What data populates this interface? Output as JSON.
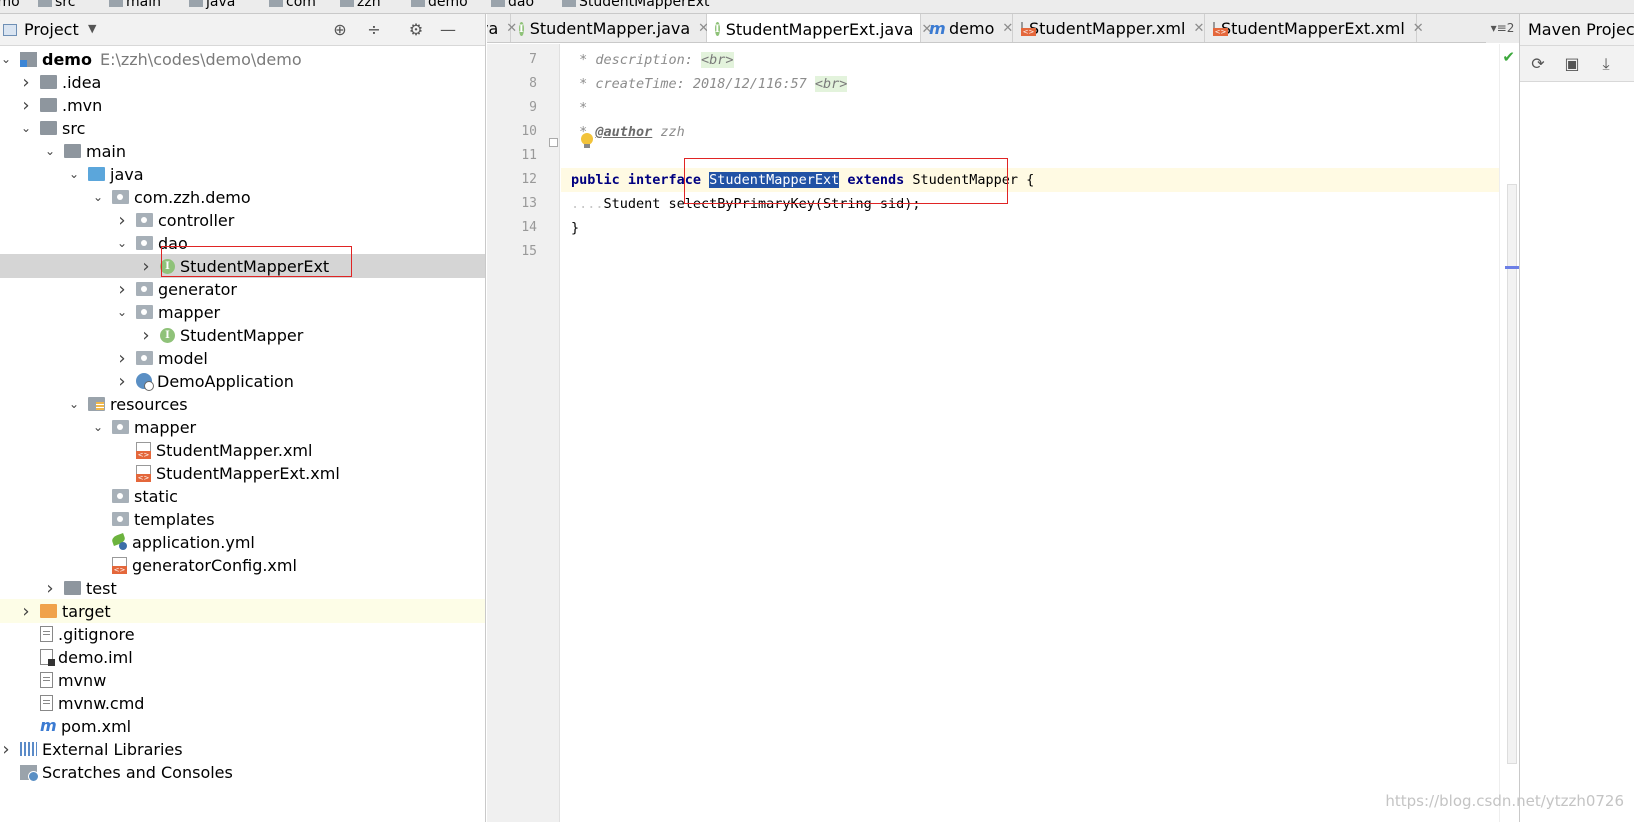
{
  "breadcrumb": [
    "demo",
    "src",
    "main",
    "java",
    "com",
    "zzh",
    "demo",
    "dao",
    "StudentMapperExt"
  ],
  "project_panel": {
    "title": "Project",
    "tree": [
      {
        "label": "demo",
        "path": "E:\\zzh\\codes\\demo\\demo",
        "depth": 0,
        "arrow": "down",
        "icon": "module-icon",
        "bold": true
      },
      {
        "label": ".idea",
        "depth": 1,
        "arrow": "right",
        "icon": "folder-icon"
      },
      {
        "label": ".mvn",
        "depth": 1,
        "arrow": "right",
        "icon": "folder-icon"
      },
      {
        "label": "src",
        "depth": 1,
        "arrow": "down",
        "icon": "folder-icon"
      },
      {
        "label": "main",
        "depth": 2,
        "arrow": "down",
        "icon": "folder-icon"
      },
      {
        "label": "java",
        "depth": 3,
        "arrow": "down",
        "icon": "source-folder-icon"
      },
      {
        "label": "com.zzh.demo",
        "depth": 4,
        "arrow": "down",
        "icon": "package-icon"
      },
      {
        "label": "controller",
        "depth": 5,
        "arrow": "right",
        "icon": "package-icon"
      },
      {
        "label": "dao",
        "depth": 5,
        "arrow": "down",
        "icon": "package-icon"
      },
      {
        "label": "StudentMapperExt",
        "depth": 6,
        "arrow": "right",
        "icon": "interface-icon",
        "selected": true
      },
      {
        "label": "generator",
        "depth": 5,
        "arrow": "right",
        "icon": "package-icon"
      },
      {
        "label": "mapper",
        "depth": 5,
        "arrow": "down",
        "icon": "package-icon"
      },
      {
        "label": "StudentMapper",
        "depth": 6,
        "arrow": "right",
        "icon": "interface-icon"
      },
      {
        "label": "model",
        "depth": 5,
        "arrow": "right",
        "icon": "package-icon"
      },
      {
        "label": "DemoApplication",
        "depth": 5,
        "arrow": "right",
        "icon": "spring-app-icon"
      },
      {
        "label": "resources",
        "depth": 3,
        "arrow": "down",
        "icon": "resources-folder-icon"
      },
      {
        "label": "mapper",
        "depth": 4,
        "arrow": "down",
        "icon": "package-icon"
      },
      {
        "label": "StudentMapper.xml",
        "depth": 5,
        "arrow": "none",
        "icon": "xml-file-icon"
      },
      {
        "label": "StudentMapperExt.xml",
        "depth": 5,
        "arrow": "none",
        "icon": "xml-file-icon"
      },
      {
        "label": "static",
        "depth": 4,
        "arrow": "none",
        "icon": "package-icon"
      },
      {
        "label": "templates",
        "depth": 4,
        "arrow": "none",
        "icon": "package-icon"
      },
      {
        "label": "application.yml",
        "depth": 4,
        "arrow": "none",
        "icon": "yml-file-icon"
      },
      {
        "label": "generatorConfig.xml",
        "depth": 4,
        "arrow": "none",
        "icon": "xml-file-icon"
      },
      {
        "label": "test",
        "depth": 2,
        "arrow": "right",
        "icon": "folder-icon"
      },
      {
        "label": "target",
        "depth": 1,
        "arrow": "right",
        "icon": "excluded-folder-icon",
        "highlight": true
      },
      {
        "label": ".gitignore",
        "depth": 1,
        "arrow": "none",
        "icon": "text-file-icon"
      },
      {
        "label": "demo.iml",
        "depth": 1,
        "arrow": "none",
        "icon": "iml-file-icon"
      },
      {
        "label": "mvnw",
        "depth": 1,
        "arrow": "none",
        "icon": "text-file-icon"
      },
      {
        "label": "mvnw.cmd",
        "depth": 1,
        "arrow": "none",
        "icon": "text-file-icon"
      },
      {
        "label": "pom.xml",
        "depth": 1,
        "arrow": "none",
        "icon": "maven-icon"
      },
      {
        "label": "External Libraries",
        "depth": 0,
        "arrow": "right",
        "icon": "libraries-icon"
      },
      {
        "label": "Scratches and Consoles",
        "depth": 0,
        "arrow": "none",
        "icon": "scratches-icon"
      }
    ]
  },
  "editor": {
    "tabs": [
      {
        "label": "va",
        "icon": "none"
      },
      {
        "label": "StudentMapper.java",
        "icon": "interface-icon"
      },
      {
        "label": "StudentMapperExt.java",
        "icon": "interface-icon",
        "active": true
      },
      {
        "label": "demo",
        "icon": "maven-icon"
      },
      {
        "label": "StudentMapper.xml",
        "icon": "xml-file-icon"
      },
      {
        "label": "StudentMapperExt.xml",
        "icon": "xml-file-icon"
      }
    ],
    "tab_overflow": "2",
    "lines": [
      {
        "n": "7",
        "parts": [
          {
            "t": " * description: ",
            "c": "cmt"
          },
          {
            "t": "<br>",
            "c": "tag"
          }
        ]
      },
      {
        "n": "8",
        "parts": [
          {
            "t": " * createTime: 2018/12/116:57 ",
            "c": "cmt"
          },
          {
            "t": "<br>",
            "c": "tag"
          }
        ]
      },
      {
        "n": "9",
        "parts": [
          {
            "t": " *",
            "c": "cmt"
          }
        ]
      },
      {
        "n": "10",
        "parts": [
          {
            "t": " * ",
            "c": "cmt"
          },
          {
            "t": "@author",
            "c": "ann"
          },
          {
            "t": " zzh",
            "c": "cmt"
          }
        ]
      },
      {
        "n": "11",
        "parts": [
          {
            "t": " ",
            "c": ""
          }
        ]
      },
      {
        "n": "12",
        "current": true,
        "parts": [
          {
            "t": "public interface ",
            "c": "kw"
          },
          {
            "t": "StudentMapperExt",
            "c": "sel-text"
          },
          {
            "t": " ",
            "c": ""
          },
          {
            "t": "extends",
            "c": "kw"
          },
          {
            "t": " StudentMapper {",
            "c": ""
          }
        ]
      },
      {
        "n": "13",
        "parts": [
          {
            "t": "....",
            "c": "dot"
          },
          {
            "t": "Student selectByPrimaryKey(String sid);",
            "c": ""
          }
        ]
      },
      {
        "n": "14",
        "parts": [
          {
            "t": "}",
            "c": ""
          }
        ]
      },
      {
        "n": "15",
        "parts": [
          {
            "t": "",
            "c": ""
          }
        ]
      }
    ]
  },
  "maven_panel": {
    "title": "Maven Projects"
  },
  "watermark": "https://blog.csdn.net/ytzzh0726"
}
